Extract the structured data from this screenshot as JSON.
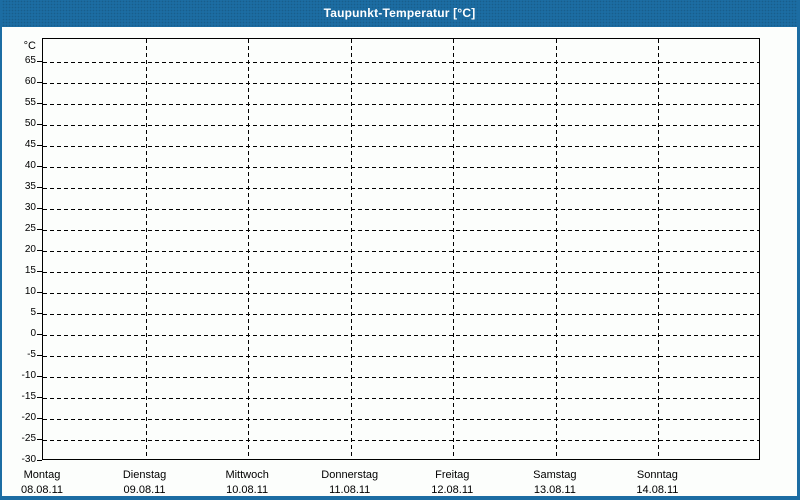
{
  "window": {
    "title": "Taupunkt-Temperatur [°C]"
  },
  "colors": {
    "titlebar": "#1c6da3",
    "border": "#1c6da3",
    "background": "#fcfefc",
    "axis": "#000000",
    "title_text": "#ffffff"
  },
  "chart_data": {
    "type": "line",
    "title": "Taupunkt-Temperatur [°C]",
    "ylabel": "°C",
    "ylim": [
      -30,
      70
    ],
    "yticks": [
      65,
      60,
      55,
      50,
      45,
      40,
      35,
      30,
      25,
      20,
      15,
      10,
      5,
      0,
      -5,
      -10,
      -15,
      -20,
      -25,
      -30
    ],
    "grid": "dashed",
    "legend": "none",
    "x_categories": [
      {
        "day": "Montag",
        "date": "08.08.11"
      },
      {
        "day": "Dienstag",
        "date": "09.08.11"
      },
      {
        "day": "Mittwoch",
        "date": "10.08.11"
      },
      {
        "day": "Donnerstag",
        "date": "11.08.11"
      },
      {
        "day": "Freitag",
        "date": "12.08.11"
      },
      {
        "day": "Samstag",
        "date": "13.08.11"
      },
      {
        "day": "Sonntag",
        "date": "14.08.11"
      }
    ],
    "series": []
  }
}
